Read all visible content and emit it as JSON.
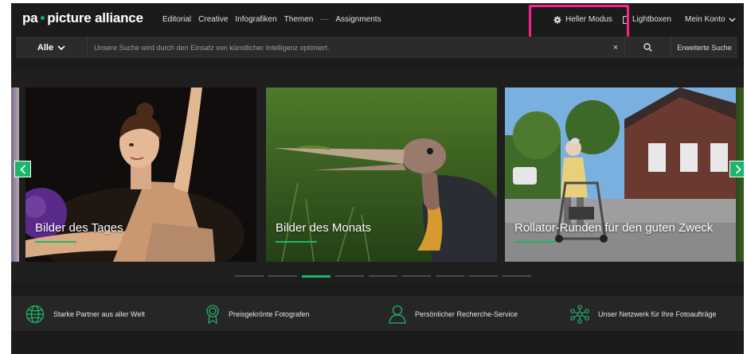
{
  "header": {
    "brand_prefix": "pa",
    "brand_name": "picture alliance",
    "nav": [
      "Editorial",
      "Creative",
      "Infografiken",
      "Themen",
      "Assignments"
    ],
    "mode_label": "Heller Modus",
    "lightbox_label": "Lightboxen",
    "account_label": "Mein Konto"
  },
  "search": {
    "scope_label": "Alle",
    "placeholder": "Unsere Suche wird durch den Einsatz von künstlicher Intelligenz optimiert.",
    "clear_symbol": "×",
    "advanced_label": "Erweiterte Suche"
  },
  "carousel": {
    "slides": [
      {
        "title": "Bilder des Tages"
      },
      {
        "title": "Bilder des Monats"
      },
      {
        "title": "Rollator-Runden für den guten Zweck"
      }
    ],
    "dot_count": 9,
    "active_dot": 2
  },
  "features": [
    {
      "label": "Starke Partner aus aller Welt",
      "icon": "globe-icon"
    },
    {
      "label": "Preisgekrönte Fotografen",
      "icon": "award-icon"
    },
    {
      "label": "Persönlicher Recherche-Service",
      "icon": "person-icon"
    },
    {
      "label": "Unser Netzwerk für Ihre Fotoaufträge",
      "icon": "network-icon"
    }
  ],
  "colors": {
    "accent": "#1db56a",
    "highlight": "#ff1f8e",
    "background": "#1b1b1b"
  }
}
